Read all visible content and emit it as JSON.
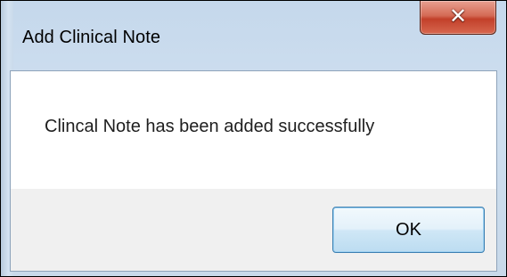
{
  "window": {
    "title": "Add Clinical Note",
    "close_icon": "close-x-icon",
    "accent_colors": {
      "close_button": "#c9462f",
      "frame": "#c8d9ea",
      "ok_button_border": "#3c7fb1"
    }
  },
  "dialog": {
    "message": "Clincal Note has been added successfully",
    "ok_label": "OK"
  }
}
